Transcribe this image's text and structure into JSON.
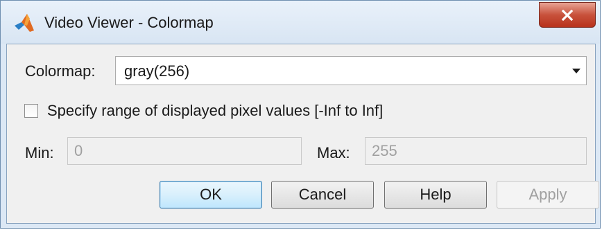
{
  "window": {
    "title": "Video Viewer - Colormap",
    "close_glyph": "X"
  },
  "colormap": {
    "label": "Colormap:",
    "selected": "gray(256)"
  },
  "range": {
    "checkbox_label": "Specify range of displayed pixel values [-Inf to Inf]",
    "checked": false,
    "min_label": "Min:",
    "min_value": "0",
    "max_label": "Max:",
    "max_value": "255"
  },
  "buttons": {
    "ok": "OK",
    "cancel": "Cancel",
    "help": "Help",
    "apply": "Apply"
  },
  "colors": {
    "default_button_border": "#3c7fb1",
    "close_button": "#c8523c",
    "disabled_text": "#a0a0a0"
  },
  "icons": {
    "app": "matlab-logo-icon",
    "close": "close-icon",
    "dropdown": "chevron-down-icon"
  }
}
